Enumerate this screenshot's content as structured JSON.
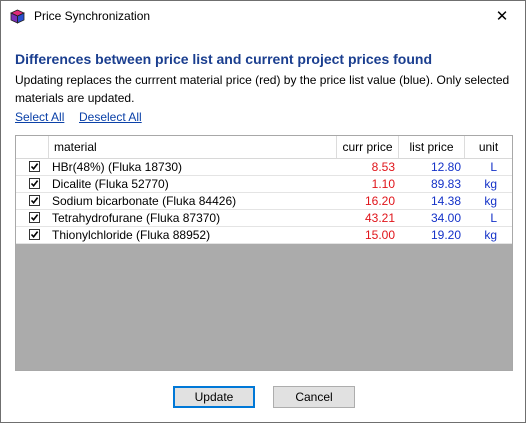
{
  "window": {
    "title": "Price Synchronization",
    "close_glyph": "✕",
    "app_icon": "app-cube-icon"
  },
  "heading": "Differences between price list and current project prices found",
  "description": "Updating replaces the currrent material price (red) by the price list value (blue). Only selected materials are updated.",
  "links": {
    "select_all": "Select All",
    "deselect_all": "Deselect All"
  },
  "table": {
    "columns": {
      "material": "material",
      "curr_price": "curr price",
      "list_price": "list price",
      "unit": "unit"
    },
    "rows": [
      {
        "checked": true,
        "material": "HBr(48%) (Fluka 18730)",
        "curr_price": "8.53",
        "list_price": "12.80",
        "unit": "L"
      },
      {
        "checked": true,
        "material": "Dicalite (Fluka 52770)",
        "curr_price": "1.10",
        "list_price": "89.83",
        "unit": "kg"
      },
      {
        "checked": true,
        "material": "Sodium bicarbonate (Fluka 84426)",
        "curr_price": "16.20",
        "list_price": "14.38",
        "unit": "kg"
      },
      {
        "checked": true,
        "material": "Tetrahydrofurane (Fluka 87370)",
        "curr_price": "43.21",
        "list_price": "34.00",
        "unit": "L"
      },
      {
        "checked": true,
        "material": "Thionylchloride (Fluka 88952)",
        "curr_price": "15.00",
        "list_price": "19.20",
        "unit": "kg"
      }
    ]
  },
  "buttons": {
    "update": "Update",
    "cancel": "Cancel"
  },
  "colors": {
    "current_price": "#e0141a",
    "list_price": "#1432c8",
    "heading": "#1a3e8f",
    "link": "#0b41a8"
  }
}
